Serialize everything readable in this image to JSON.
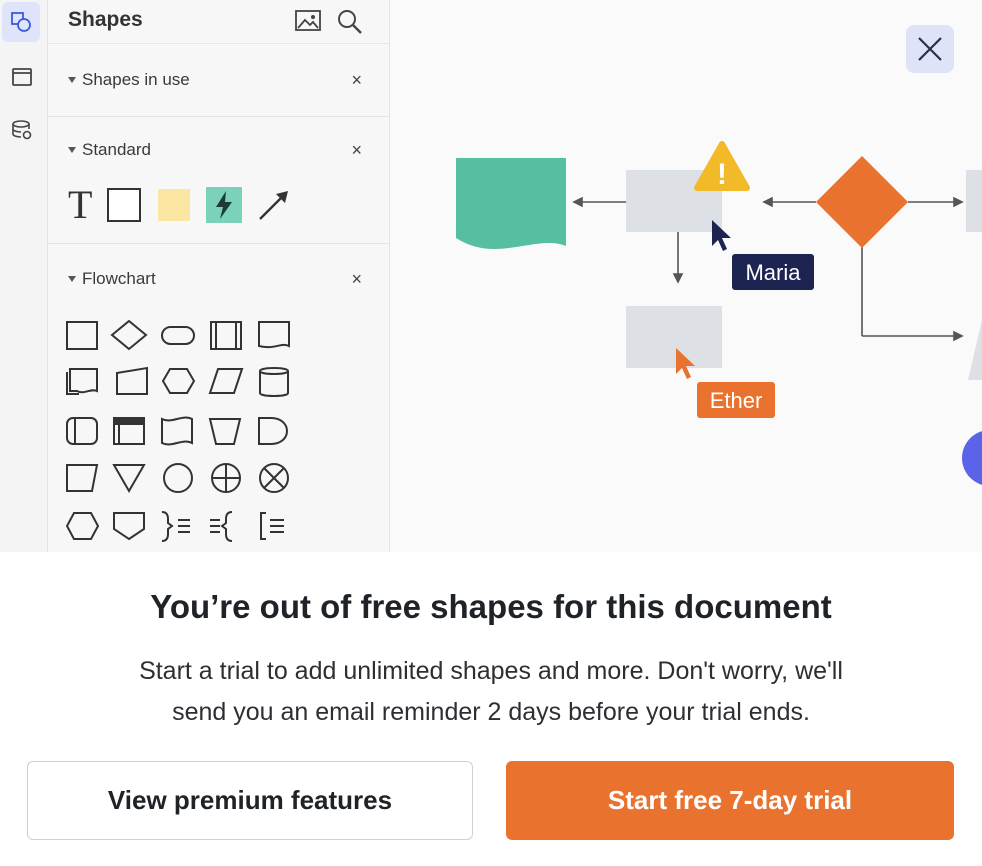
{
  "panel": {
    "title": "Shapes",
    "sections": [
      {
        "label": "Shapes in use",
        "close": "×"
      },
      {
        "label": "Standard",
        "close": "×"
      },
      {
        "label": "Flowchart",
        "close": "×"
      }
    ],
    "standard_text_glyph": "T"
  },
  "canvas": {
    "cursor_labels": [
      "Maria",
      "Ether"
    ],
    "warning_glyph": "!"
  },
  "dialog": {
    "headline": "You’re out of free shapes for this document",
    "line1": "Start a trial to add unlimited shapes and more. Don't worry, we'll",
    "line2": "send you an email reminder 2 days before your trial ends.",
    "secondary_button": "View premium features",
    "primary_button": "Start free 7-day trial"
  },
  "colors": {
    "accent_orange": "#e8722e",
    "teal": "#56bfa2",
    "navy": "#1d2452",
    "warning_yellow": "#f2b928",
    "close_bg": "#dfe3fa"
  }
}
